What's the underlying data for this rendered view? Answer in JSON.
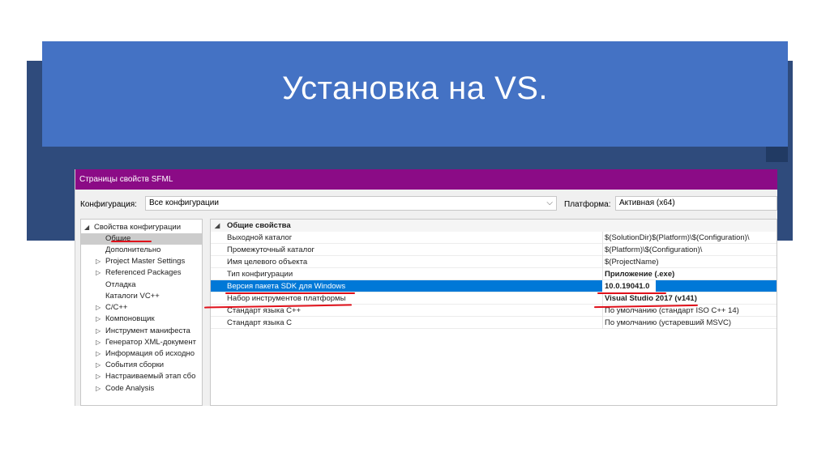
{
  "slide": {
    "title": "Установка на VS."
  },
  "dialog": {
    "title": "Страницы свойств SFML",
    "config_label": "Конфигурация:",
    "config_value": "Все конфигурации",
    "platform_label": "Платформа:",
    "platform_value": "Активная (x64)"
  },
  "tree": {
    "items": [
      {
        "label": "Свойства конфигурации",
        "arrow": "◢"
      },
      {
        "label": "Общие",
        "arrow": ""
      },
      {
        "label": "Дополнительно",
        "arrow": ""
      },
      {
        "label": "Project Master Settings",
        "arrow": "▷"
      },
      {
        "label": "Referenced Packages",
        "arrow": "▷"
      },
      {
        "label": "Отладка",
        "arrow": ""
      },
      {
        "label": "Каталоги VC++",
        "arrow": ""
      },
      {
        "label": "C/C++",
        "arrow": "▷"
      },
      {
        "label": "Компоновщик",
        "arrow": "▷"
      },
      {
        "label": "Инструмент манифеста",
        "arrow": "▷"
      },
      {
        "label": "Генератор XML-документ",
        "arrow": "▷"
      },
      {
        "label": "Информация об исходно",
        "arrow": "▷"
      },
      {
        "label": "События сборки",
        "arrow": "▷"
      },
      {
        "label": "Настраиваемый этап сбо",
        "arrow": "▷"
      },
      {
        "label": "Code Analysis",
        "arrow": "▷"
      }
    ]
  },
  "grid": {
    "category": "Общие свойства",
    "category_arrow": "◢",
    "rows": [
      {
        "name": "Выходной каталог",
        "value": "$(SolutionDir)$(Platform)\\$(Configuration)\\"
      },
      {
        "name": "Промежуточный каталог",
        "value": "$(Platform)\\$(Configuration)\\"
      },
      {
        "name": "Имя целевого объекта",
        "value": "$(ProjectName)"
      },
      {
        "name": "Тип конфигурации",
        "value": "Приложение (.exe)"
      },
      {
        "name": "Версия пакета SDK для Windows",
        "value": "10.0.19041.0"
      },
      {
        "name": "Набор инструментов платформы",
        "value": "Visual Studio 2017 (v141)"
      },
      {
        "name": "Стандарт языка C++",
        "value": "По умолчанию (стандарт ISO C++ 14)"
      },
      {
        "name": "Стандарт языка C",
        "value": "По умолчанию (устаревший MSVC)"
      }
    ]
  },
  "colors": {
    "banner": "#4472c4",
    "titlebar": "#8b0b86",
    "selection": "#0078d7",
    "annotation": "#e0101a"
  }
}
